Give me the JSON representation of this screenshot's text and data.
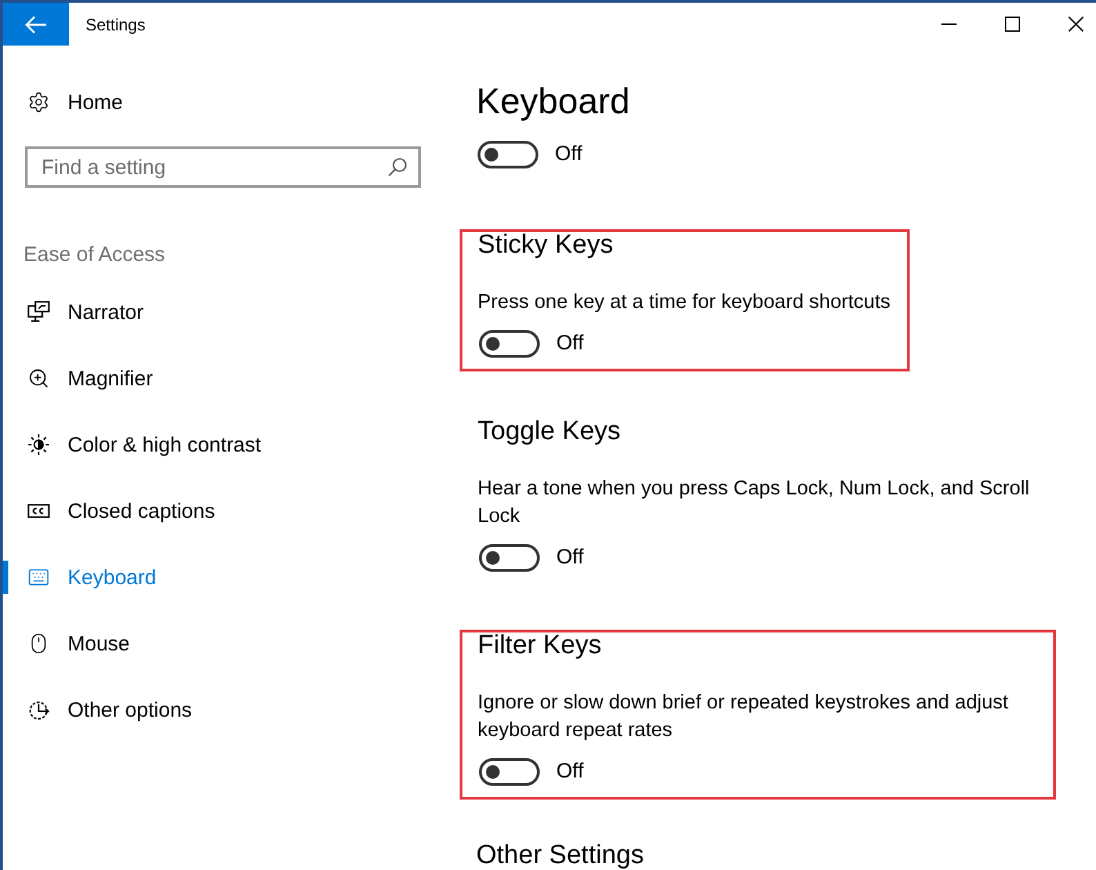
{
  "window": {
    "title": "Settings"
  },
  "sidebar": {
    "home": "Home",
    "search": {
      "placeholder": "Find a setting"
    },
    "group_label": "Ease of Access",
    "items": [
      {
        "label": "Narrator",
        "kind": "narrator",
        "selected": false
      },
      {
        "label": "Magnifier",
        "kind": "magnifier",
        "selected": false
      },
      {
        "label": "Color & high contrast",
        "kind": "contrast",
        "selected": false
      },
      {
        "label": "Closed captions",
        "kind": "captions",
        "selected": false
      },
      {
        "label": "Keyboard",
        "kind": "keyboard",
        "selected": true
      },
      {
        "label": "Mouse",
        "kind": "mouse",
        "selected": false
      },
      {
        "label": "Other options",
        "kind": "other",
        "selected": false
      }
    ]
  },
  "page": {
    "title": "Keyboard",
    "toggle": {
      "on": false,
      "state": "Off"
    },
    "sections": [
      {
        "title": "Sticky Keys",
        "description": "Press one key at a time for keyboard shortcuts",
        "toggle": {
          "on": false,
          "state": "Off"
        },
        "highlighted": true
      },
      {
        "title": "Toggle Keys",
        "description": "Hear a tone when you press Caps Lock, Num Lock, and Scroll Lock",
        "toggle": {
          "on": false,
          "state": "Off"
        },
        "highlighted": false
      },
      {
        "title": "Filter Keys",
        "description": "Ignore or slow down brief or repeated keystrokes and adjust keyboard repeat rates",
        "toggle": {
          "on": false,
          "state": "Off"
        },
        "highlighted": true
      }
    ],
    "next_heading": "Other Settings"
  }
}
